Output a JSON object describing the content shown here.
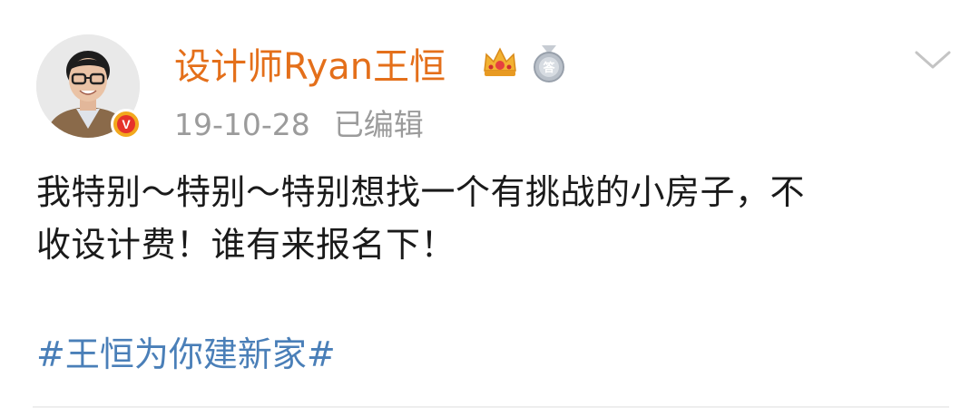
{
  "post": {
    "username": "设计师Ryan王恒",
    "timestamp": "19-10-28",
    "edited_label": "已编辑",
    "body_lines": [
      "我特别～特别～特别想找一个有挑战的小房子，不",
      "收设计费！谁有来报名下！"
    ],
    "hashtag": "#王恒为你建新家#",
    "verified_badge_letter": "V",
    "medal_char": "答"
  },
  "icons": {
    "verified": "verified-v-badge-icon",
    "crown": "crown-icon",
    "medal": "answer-medal-icon",
    "more": "chevron-down-icon"
  },
  "colors": {
    "username": "#e46f1a",
    "meta": "#9b9b9b",
    "body": "#1a1a1a",
    "hashtag": "#4a7fb8",
    "verified_outer": "#f2a81d",
    "verified_inner": "#e6332a"
  }
}
